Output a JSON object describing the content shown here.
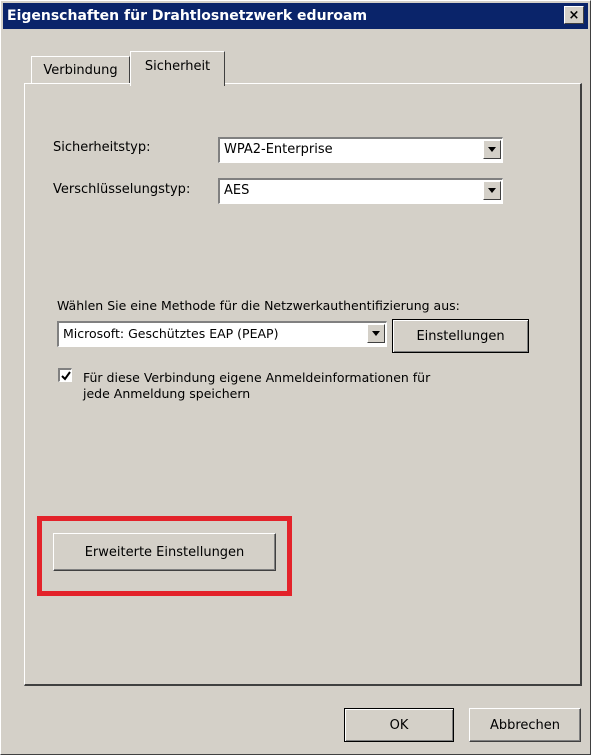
{
  "window": {
    "title": "Eigenschaften für Drahtlosnetzwerk eduroam",
    "close_label": "×"
  },
  "tabs": [
    {
      "label": "Verbindung",
      "active": false
    },
    {
      "label": "Sicherheit",
      "active": true
    }
  ],
  "security": {
    "type_label": "Sicherheitstyp:",
    "type_value": "WPA2-Enterprise",
    "encryption_label": "Verschlüsselungstyp:",
    "encryption_value": "AES"
  },
  "auth": {
    "method_label": "Wählen Sie eine Methode für die Netzwerkauthentifizierung aus:",
    "method_value": "Microsoft: Geschütztes EAP (PEAP)",
    "settings_button": "Einstellungen",
    "remember_checked": true,
    "remember_label_line1": "Für diese Verbindung eigene Anmeldeinformationen für",
    "remember_label_line2": "jede Anmeldung speichern"
  },
  "advanced_button": "Erweiterte Einstellungen",
  "footer": {
    "ok": "OK",
    "cancel": "Abbrechen"
  },
  "colors": {
    "titlebar": "#0a246a",
    "highlight_frame": "#e3222a",
    "dialog_face": "#d4d0c8"
  }
}
